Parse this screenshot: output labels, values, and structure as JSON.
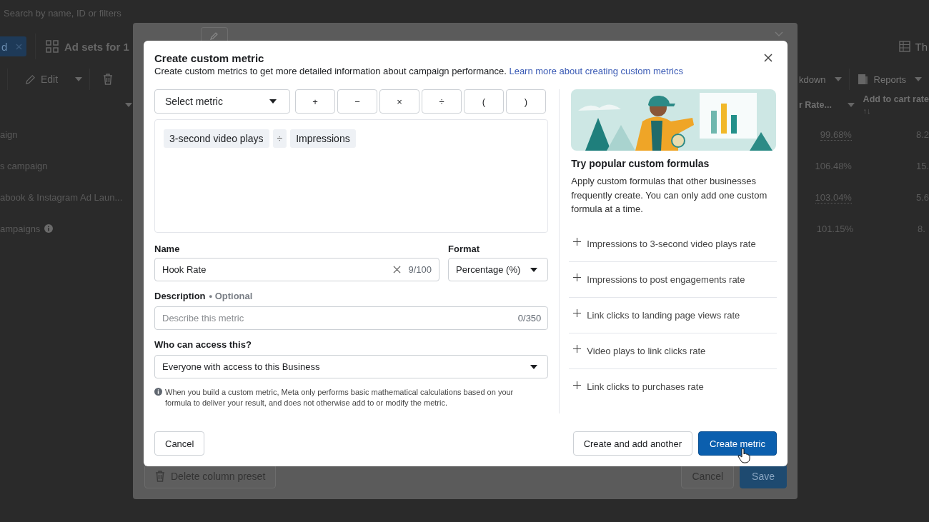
{
  "background_page": {
    "search": {
      "placeholder": "Search by name, ID or filters"
    },
    "filter_chip": {
      "label": "d"
    },
    "tab": {
      "label": "Ad sets for 1"
    },
    "view_button": {
      "label": "Th"
    },
    "toolbar": {
      "edit": "Edit",
      "breakdown": "kdown",
      "reports": "Reports"
    },
    "columns": [
      {
        "label": "r Rate..."
      },
      {
        "label": "Add to cart rate",
        "sort": "↑↓"
      }
    ],
    "rows": [
      {
        "name": "aign",
        "info": false,
        "rate": "99.68%",
        "underlined": true,
        "add_to_cart": "8.2"
      },
      {
        "name": "s campaign",
        "info": false,
        "rate": "106.48%",
        "underlined": false,
        "add_to_cart": "15."
      },
      {
        "name": "abook & Instagram Ad Laun...",
        "info": false,
        "rate": "103.04%",
        "underlined": true,
        "add_to_cart": "5.6"
      },
      {
        "name": "ampaigns",
        "info": true,
        "rate": "101.15%",
        "underlined": false,
        "add_to_cart": "8."
      }
    ]
  },
  "column_editor": {
    "footer": {
      "delete": "Delete column preset",
      "cancel": "Cancel",
      "save": "Save"
    }
  },
  "dialog": {
    "title": "Create custom metric",
    "subtitle": "Create custom metrics to get more detailed information about campaign performance.",
    "link": "Learn more about creating custom metrics",
    "metric_select": {
      "placeholder": "Select metric"
    },
    "operators": [
      "+",
      "−",
      "×",
      "÷",
      "(",
      ")"
    ],
    "formula": [
      {
        "kind": "metric",
        "text": "3-second video plays"
      },
      {
        "kind": "operator",
        "text": "÷"
      },
      {
        "kind": "metric",
        "text": "Impressions"
      }
    ],
    "name": {
      "label": "Name",
      "value": "Hook Rate",
      "counter": "9/100"
    },
    "format": {
      "label": "Format",
      "value": "Percentage (%)"
    },
    "description": {
      "label": "Description",
      "optional": "• Optional",
      "placeholder": "Describe this metric",
      "counter": "0/350"
    },
    "access": {
      "label": "Who can access this?",
      "value": "Everyone with access to this Business"
    },
    "note": "When you build a custom metric, Meta only performs basic mathematical calculations based on your formula to deliver your result, and does not otherwise add to or modify the metric.",
    "suggestions": {
      "title": "Try popular custom formulas",
      "text": "Apply custom formulas that other businesses frequently create. You can only add one custom formula at a time.",
      "items": [
        "Impressions to 3-second video plays rate",
        "Impressions to post engagements rate",
        "Link clicks to landing page views rate",
        "Video plays to link clicks rate",
        "Link clicks to purchases rate"
      ]
    },
    "buttons": {
      "cancel": "Cancel",
      "secondary": "Create and add another",
      "primary": "Create metric"
    }
  }
}
